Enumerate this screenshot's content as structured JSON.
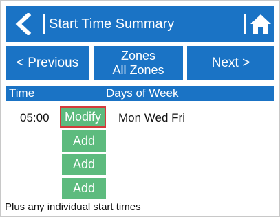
{
  "header": {
    "title": "Start Time Summary",
    "back_icon": "chevron-left-icon",
    "home_icon": "home-icon"
  },
  "nav": {
    "previous_label": "< Previous",
    "zones_line1": "Zones",
    "zones_line2": "All Zones",
    "next_label": "Next >"
  },
  "table": {
    "col_time": "Time",
    "col_days": "Days of Week",
    "rows": [
      {
        "time": "05:00",
        "action": "Modify",
        "days": "Mon Wed Fri"
      },
      {
        "time": "",
        "action": "Add",
        "days": ""
      },
      {
        "time": "",
        "action": "Add",
        "days": ""
      },
      {
        "time": "",
        "action": "Add",
        "days": ""
      }
    ]
  },
  "footer": {
    "note": "Plus any individual start times"
  },
  "colors": {
    "primary_blue": "#1a73c5",
    "action_green": "#5dbb7e",
    "highlight_red": "#d43a3a"
  }
}
